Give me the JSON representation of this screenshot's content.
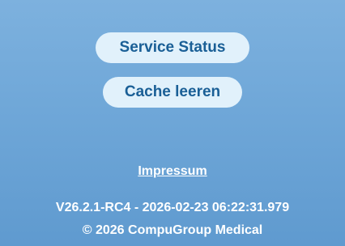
{
  "buttons": {
    "service_status": "Service Status",
    "clear_cache": "Cache leeren"
  },
  "footer": {
    "impressum_link": "Impressum",
    "version": "V26.2.1-RC4 - 2026-02-23 06:22:31.979",
    "copyright": "© 2026 CompuGroup Medical"
  },
  "colors": {
    "background_top": "#7db1de",
    "background_bottom": "#5f9acf",
    "button_background": "#e1f1fb",
    "button_text": "#1a5f96",
    "footer_text": "#ffffff"
  }
}
